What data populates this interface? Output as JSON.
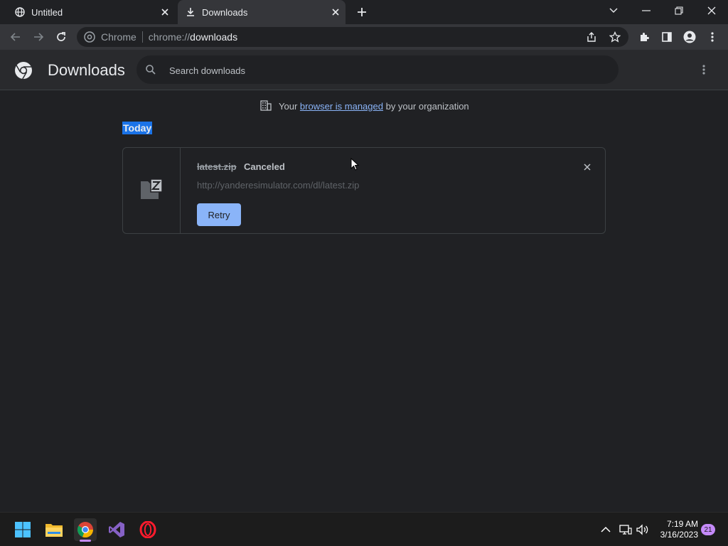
{
  "tabs": [
    {
      "title": "Untitled",
      "icon": "globe-icon"
    },
    {
      "title": "Downloads",
      "icon": "download-icon"
    }
  ],
  "omnibox": {
    "site": "Chrome",
    "scheme": "chrome://",
    "host": "downloads"
  },
  "header": {
    "title": "Downloads",
    "search_placeholder": "Search downloads"
  },
  "managed": {
    "prefix": "Your",
    "link": "browser is managed",
    "suffix": "by your organization"
  },
  "section": {
    "label": "Today"
  },
  "download": {
    "filename": "latest.zip",
    "status": "Canceled",
    "url": "http://yanderesimulator.com/dl/latest.zip",
    "retry_label": "Retry",
    "file_icon": "zip-file-icon"
  },
  "taskbar": {
    "apps": [
      "windows-start-icon",
      "file-explorer-icon",
      "chrome-icon",
      "visual-studio-icon",
      "opera-icon"
    ],
    "time": "7:19 AM",
    "date": "3/16/2023",
    "notifications": "21"
  },
  "colors": {
    "accent": "#8ab4f8",
    "background": "#202124",
    "toolbar": "#35363a",
    "selection": "#1a73e8"
  }
}
